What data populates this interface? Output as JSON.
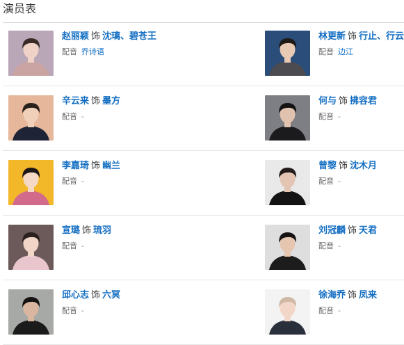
{
  "section_title": "演员表",
  "shi": "饰",
  "voice_label": "配音",
  "cast": [
    {
      "actor": "赵丽颖",
      "role": "沈璃、碧苍王",
      "voice": "乔诗语",
      "bg": "#b9a6b7",
      "skin": "#f0d3c6",
      "hair": "#3a2b28",
      "cloth": "#c9a4a2"
    },
    {
      "actor": "林更新",
      "role": "行止、行云",
      "voice": "边江",
      "bg": "#2b4d7a",
      "skin": "#e8c9b4",
      "hair": "#1e1a18",
      "cloth": "#4b4b50"
    },
    {
      "actor": "辛云来",
      "role": "墨方",
      "voice": "-",
      "bg": "#e6b79a",
      "skin": "#f1d0ba",
      "hair": "#2a211d",
      "cloth": "#1e2336"
    },
    {
      "actor": "何与",
      "role": "拂容君",
      "voice": "-",
      "bg": "#7d7f84",
      "skin": "#e0c2ae",
      "hair": "#141313",
      "cloth": "#1b1b1d"
    },
    {
      "actor": "李嘉琦",
      "role": "幽兰",
      "voice": "-",
      "bg": "#f3b72a",
      "skin": "#f6d8c6",
      "hair": "#1f1716",
      "cloth": "#d26b8b"
    },
    {
      "actor": "曾黎",
      "role": "沈木月",
      "voice": "-",
      "bg": "#e9e9ea",
      "skin": "#e4c4b2",
      "hair": "#221b19",
      "cloth": "#141414"
    },
    {
      "actor": "宣璐",
      "role": "琉羽",
      "voice": "-",
      "bg": "#6c5a5a",
      "skin": "#f1d6c8",
      "hair": "#2a201d",
      "cloth": "#e9c6cd"
    },
    {
      "actor": "刘冠麟",
      "role": "天君",
      "voice": "-",
      "bg": "#dedede",
      "skin": "#e6c6b1",
      "hair": "#171312",
      "cloth": "#1d1c1c"
    },
    {
      "actor": "邱心志",
      "role": "六冥",
      "voice": "-",
      "bg": "#a7a9a6",
      "skin": "#d9b6a0",
      "hair": "#141312",
      "cloth": "#1b1b1b"
    },
    {
      "actor": "徐海乔",
      "role": "凤来",
      "voice": "-",
      "bg": "#f3f3f3",
      "skin": "#f2d7c9",
      "hair": "#cfb8a4",
      "cloth": "#2a2f3c"
    }
  ]
}
